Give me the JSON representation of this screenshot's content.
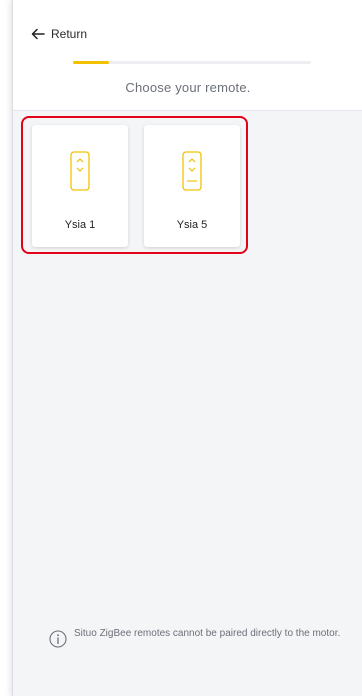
{
  "header": {
    "return_label": "Return",
    "step_title": "Choose your remote.",
    "progress": 0.15
  },
  "remotes": [
    {
      "label": "Ysia 1"
    },
    {
      "label": "Ysia 5"
    }
  ],
  "footer": {
    "info_text": "Situo ZigBee remotes cannot be paired directly to the motor."
  },
  "colors": {
    "accent": "#f2c200",
    "highlight": "#e2001a",
    "background": "#f4f5f7"
  },
  "icons": {
    "return": "arrow-left-icon",
    "remote": "remote-icon",
    "info": "info-icon"
  }
}
